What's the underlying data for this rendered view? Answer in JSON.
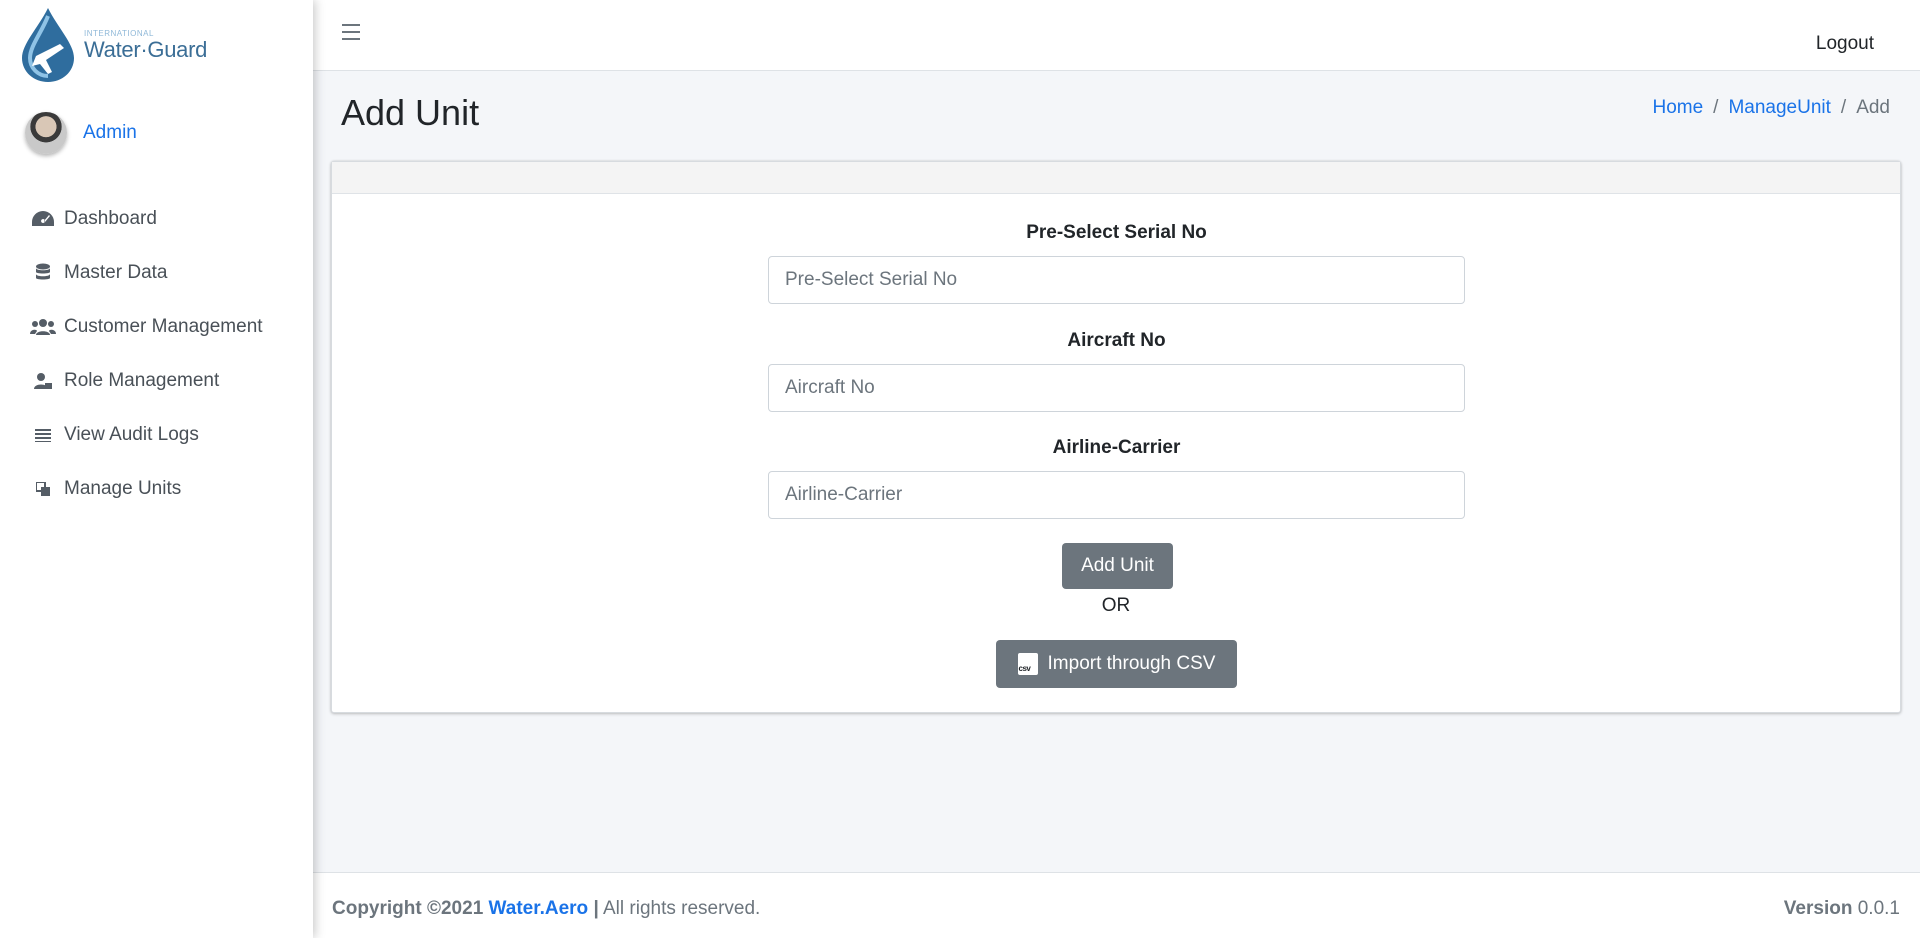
{
  "brand": {
    "small_text": "INTERNATIONAL",
    "name": "Water·Guard"
  },
  "user": {
    "name": "Admin"
  },
  "sidebar": {
    "items": [
      {
        "label": "Dashboard",
        "icon": "tachometer-icon"
      },
      {
        "label": "Master Data",
        "icon": "database-icon"
      },
      {
        "label": "Customer Management",
        "icon": "users-icon"
      },
      {
        "label": "Role Management",
        "icon": "user-lock-icon"
      },
      {
        "label": "View Audit Logs",
        "icon": "list-icon"
      },
      {
        "label": "Manage Units",
        "icon": "clone-icon"
      }
    ]
  },
  "header": {
    "logout_label": "Logout"
  },
  "page": {
    "title": "Add Unit",
    "breadcrumb": {
      "home": "Home",
      "manage": "ManageUnit",
      "current": "Add",
      "separator": "/"
    }
  },
  "form": {
    "serial": {
      "label": "Pre-Select Serial No",
      "placeholder": "Pre-Select Serial No",
      "value": ""
    },
    "aircraft": {
      "label": "Aircraft No",
      "placeholder": "Aircraft No",
      "value": ""
    },
    "airline": {
      "label": "Airline-Carrier",
      "placeholder": "Airline-Carrier",
      "value": ""
    },
    "submit_label": "Add Unit",
    "or_text": "OR",
    "import_label": "Import through CSV",
    "csv_icon_text": "csv"
  },
  "footer": {
    "copyright": "Copyright ©2021",
    "brand_link": "Water.Aero",
    "separator": "|",
    "rights": "All rights reserved.",
    "version_label": "Version",
    "version_value": "0.0.1"
  },
  "colors": {
    "accent": "#1a73e8",
    "button": "#6c757d",
    "background": "#f4f6f9"
  }
}
